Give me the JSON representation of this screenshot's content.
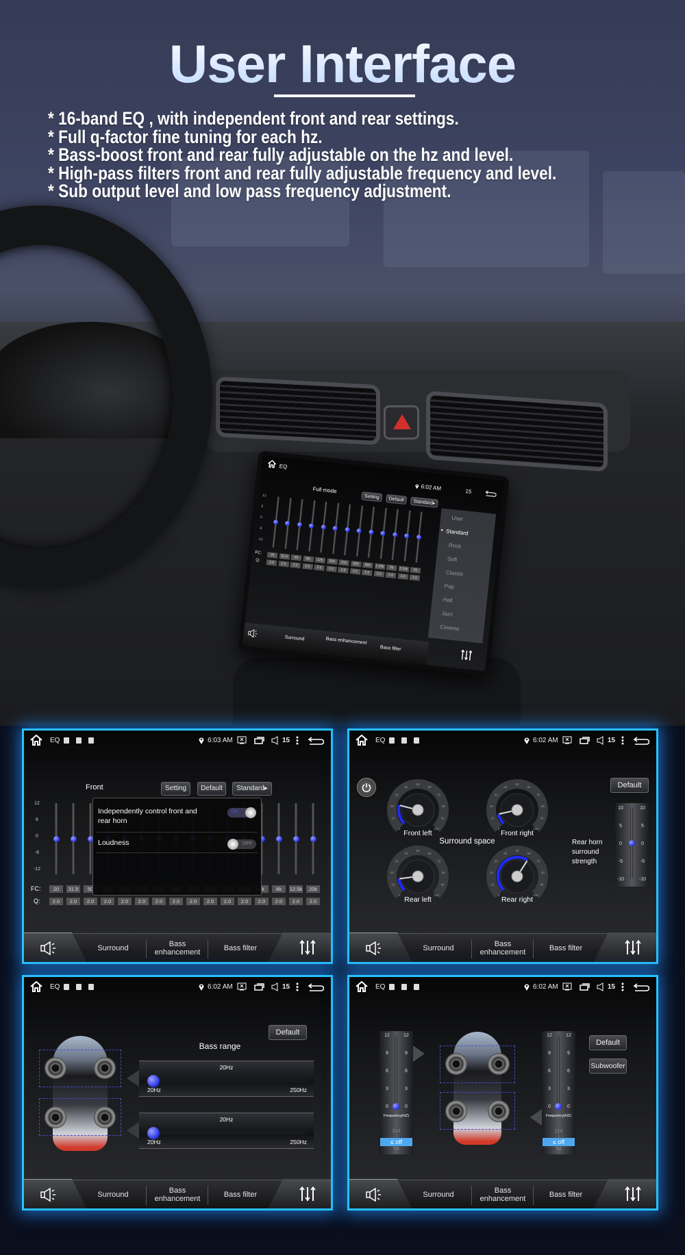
{
  "hero": {
    "title": "User Interface",
    "features": [
      "* 16-band EQ , with independent front and rear settings.",
      "* Full q-factor fine tuning for each hz.",
      "* Bass-boost front and rear fully adjustable on the hz and level.",
      "* High-pass filters front and rear fully adjustable frequency and level.",
      "* Sub output level and  low pass frequency adjustment."
    ]
  },
  "colors": {
    "accent_glow": "#27c1ff",
    "knob_blue": "#2430e0",
    "picker_highlight": "#4da8f0"
  },
  "status": {
    "eq_label": "EQ",
    "volume": "15"
  },
  "tabs": {
    "surround": "Surround",
    "bass_enhancement": "Bass enhancement",
    "bass_filter": "Bass filter"
  },
  "car_screen": {
    "time": "6:02 AM",
    "mode": "Full mode",
    "buttons": {
      "setting": "Setting",
      "default": "Default",
      "standard": "Standard▸"
    },
    "db_ticks": [
      "12",
      "6",
      "0",
      "-6",
      "-12"
    ],
    "fc_label": "FC:",
    "q_label": "Q:",
    "fc": [
      "20",
      "31.5",
      "50",
      "80",
      "125",
      "200",
      "315",
      "500",
      "800",
      "1.25k",
      "2k",
      "3.15k",
      "5k"
    ],
    "q": [
      "2.0",
      "2.0",
      "2.0",
      "2.0",
      "2.0",
      "2.0",
      "2.0",
      "2.0",
      "2.0",
      "2.0",
      "2.0",
      "2.0",
      "2.0"
    ],
    "gains_db": [
      0,
      0,
      0,
      0,
      0,
      0,
      0,
      0,
      0,
      0,
      0,
      0,
      0
    ],
    "presets": [
      "User",
      "Standard",
      "Rock",
      "Soft",
      "Classic",
      "Pop",
      "Hall",
      "Jazz",
      "Cinema"
    ],
    "selected_preset": "Standard"
  },
  "eq_panel": {
    "time": "6:03 AM",
    "channel": "Front",
    "buttons": {
      "setting": "Setting",
      "default": "Default",
      "standard": "Standard▸"
    },
    "db_ticks": [
      "12",
      "6",
      "0",
      "-6",
      "-12"
    ],
    "fc_label": "FC:",
    "q_label": "Q:",
    "fc": [
      "20",
      "31.5",
      "50",
      "80",
      "125",
      "200",
      "315",
      "500",
      "800",
      "1.25k",
      "2k",
      "3.15k",
      "5k",
      "8k",
      "12.5k",
      "20k"
    ],
    "q": [
      "2.0",
      "2.0",
      "2.0",
      "2.0",
      "2.0",
      "2.0",
      "2.0",
      "2.0",
      "2.0",
      "2.0",
      "2.0",
      "2.0",
      "2.0",
      "2.0",
      "2.0",
      "2.0"
    ],
    "gains_db": [
      0,
      0,
      0,
      0,
      0,
      0,
      0,
      0,
      0,
      0,
      0,
      0,
      0,
      0,
      0,
      0
    ],
    "popup": {
      "independent_label": "Independently control front and rear horn",
      "independent_state": "ON",
      "loudness_label": "Loudness",
      "loudness_state": "OFF"
    }
  },
  "surround_panel": {
    "time": "6:02 AM",
    "title": "Surround space",
    "default": "Default",
    "gauge_ticks": [
      "0",
      "10",
      "20",
      "30",
      "40",
      "50",
      "60",
      "70",
      "80",
      "90",
      "100"
    ],
    "gauges": [
      {
        "label": "Front left",
        "value": 22
      },
      {
        "label": "Front right",
        "value": 12
      },
      {
        "label": "Rear left",
        "value": 14
      },
      {
        "label": "Rear right",
        "value": 62
      }
    ],
    "strength_label": "Rear horn surround strength",
    "strength_ticks": [
      "10",
      "5",
      "0",
      "-5",
      "-10"
    ],
    "strength_value": 0
  },
  "bass_panel": {
    "time": "6:02 AM",
    "title": "Bass range",
    "default": "Default",
    "sliders": [
      {
        "value_label": "20Hz",
        "min": "20Hz",
        "max": "250Hz",
        "value": 20
      },
      {
        "value_label": "20Hz",
        "min": "20Hz",
        "max": "250Hz",
        "value": 20
      }
    ]
  },
  "sub_panel": {
    "time": "6:02 AM",
    "default": "Default",
    "subwoofer": "Subwoofer",
    "level_ticks": [
      "12",
      "9",
      "6",
      "3",
      "0"
    ],
    "filters": [
      {
        "freq_label": "Frequency(HZ)",
        "above": "214",
        "selected": "≤ off",
        "below": "54",
        "level": 0
      },
      {
        "freq_label": "Frequency(HZ)",
        "above": "214",
        "selected": "≤ off",
        "below": "54",
        "level": 0
      }
    ]
  }
}
